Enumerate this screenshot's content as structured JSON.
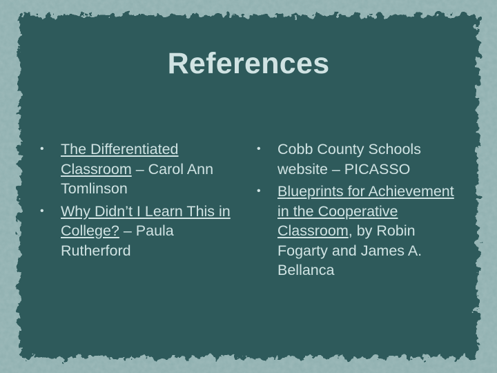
{
  "slide": {
    "title": "References",
    "colors": {
      "background": "#2e5a5b",
      "text": "#d0e3e3",
      "border": "#8fb0b0"
    },
    "left_column": [
      {
        "underlined": "The Differentiated Classroom",
        "rest": " – Carol Ann Tomlinson"
      },
      {
        "underlined": "Why Didn’t I Learn This in College?",
        "rest": " – Paula Rutherford"
      }
    ],
    "right_column": [
      {
        "underlined": "",
        "rest": "Cobb County Schools website – PICASSO"
      },
      {
        "underlined": "Blueprints for Achievement in the Cooperative Classroom",
        "rest": ", by Robin Fogarty and James A. Bellanca"
      }
    ]
  }
}
